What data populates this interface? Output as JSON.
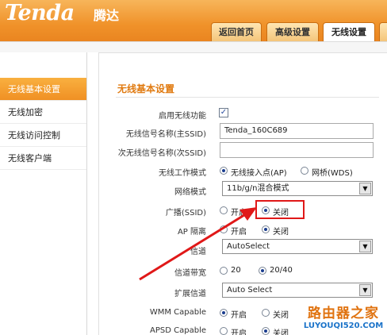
{
  "header": {
    "logo": "Tenda",
    "logo_cn": "腾达"
  },
  "tabs": [
    {
      "label": "返回首页"
    },
    {
      "label": "高级设置"
    },
    {
      "label": "无线设置"
    },
    {
      "label": ""
    }
  ],
  "sidebar": {
    "items": [
      {
        "label": "无线基本设置"
      },
      {
        "label": "无线加密"
      },
      {
        "label": "无线访问控制"
      },
      {
        "label": "无线客户端"
      }
    ]
  },
  "main": {
    "title": "无线基本设置",
    "enable_label": "启用无线功能",
    "enable_checked": true,
    "ssid_label": "无线信号名称(主SSID)",
    "ssid_value": "Tenda_160C689",
    "ssid2_label": "次无线信号名称(次SSID)",
    "ssid2_value": "",
    "mode_label": "无线工作模式",
    "mode_ap": "无线接入点(AP)",
    "mode_wds": "网桥(WDS)",
    "netmode_label": "网络模式",
    "netmode_value": "11b/g/n混合模式",
    "broadcast_label": "广播(SSID)",
    "broadcast_on": "开启",
    "broadcast_off": "关闭",
    "isolation_label": "AP 隔离",
    "isolation_on": "开启",
    "isolation_off": "关闭",
    "channel_label": "信道",
    "channel_value": "AutoSelect",
    "bandwidth_label": "信道带宽",
    "bw_20": "20",
    "bw_2040": "20/40",
    "ext_channel_label": "扩展信道",
    "ext_channel_value": "Auto Select",
    "wmm_label": "WMM Capable",
    "wmm_on": "开启",
    "wmm_off": "关闭",
    "apsd_label": "APSD Capable",
    "apsd_on": "开启",
    "apsd_off": "关闭"
  },
  "watermark": {
    "line1": "路由器之家",
    "line2": "LUYOUQI520.COM"
  },
  "colors": {
    "header": "#f0922a",
    "accent": "#e07a10",
    "highlight": "#e01818"
  }
}
